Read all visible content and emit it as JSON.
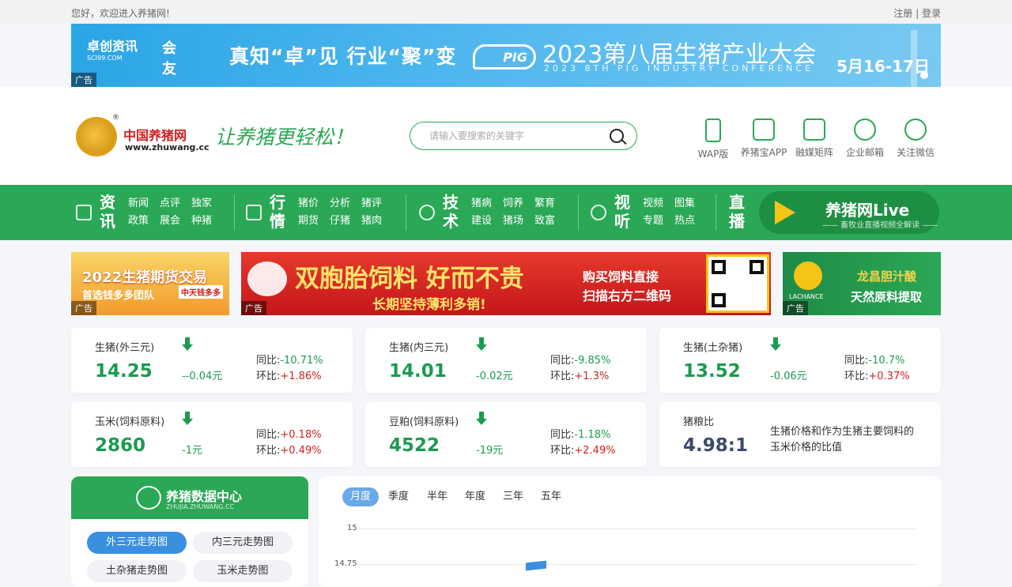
{
  "topbar": {
    "welcome": "您好，欢迎进入养猪网!",
    "register": "注册",
    "separator": "|",
    "login": "登录"
  },
  "banner": {
    "logo1": "卓创资讯",
    "logo1_sub": "SCI99.COM",
    "logo2": "会友",
    "slogan": "真知“卓”见  行业“聚”变",
    "pig_logo": "PIG",
    "conference": "2023第八届生猪产业大会",
    "conference_en": "2023 8TH PIG INDUSTRY CONFERENCE",
    "date": "5月16-17日",
    "ad_tag": "广告"
  },
  "header": {
    "logo_cn": "中国养猪网",
    "logo_en": "www.zhuwang.cc",
    "logo_mark": "®",
    "motto": "让养猪更轻松！",
    "search_placeholder": "请输入要搜索的关键字",
    "quick_links": [
      {
        "label": "WAP版",
        "icon": "phone-icon"
      },
      {
        "label": "养猪宝APP",
        "icon": "app-icon"
      },
      {
        "label": "融媒矩阵",
        "icon": "matrix-icon"
      },
      {
        "label": "企业邮箱",
        "icon": "mail-icon"
      },
      {
        "label": "关注微信",
        "icon": "wechat-icon"
      }
    ]
  },
  "nav": {
    "groups": [
      {
        "title": "资讯",
        "icon": "news-icon",
        "links": [
          "新闻",
          "点评",
          "独家",
          "政策",
          "展会",
          "种猪"
        ]
      },
      {
        "title": "行情",
        "icon": "chart-icon",
        "links": [
          "猪价",
          "分析",
          "猪评",
          "期货",
          "仔猪",
          "猪肉"
        ]
      },
      {
        "title": "技术",
        "icon": "wrench-icon",
        "links": [
          "猪病",
          "饲养",
          "繁育",
          "建设",
          "猪场",
          "致富"
        ]
      },
      {
        "title": "视听",
        "icon": "video-icon",
        "links": [
          "视频",
          "图集",
          "专题",
          "热点"
        ]
      }
    ],
    "live_label": "直播",
    "live_title": "养猪网Live",
    "live_sub": "—— 畜牧业直播视频全解读 ——"
  },
  "ads": {
    "ad1_line1": "2022生猪期货交易",
    "ad1_line2": "首选钱多多团队",
    "ad1_badge": "中天钱多多",
    "ad2_big": "双胞胎饲料 好而不贵",
    "ad2_sub": "长期坚持薄利多销!",
    "ad2_buy": "购买饲料直接",
    "ad2_scan": "扫描右方二维码",
    "ad3_brand": "LACHANCE",
    "ad3_line1": "龙昌胆汁酸",
    "ad3_line2": "天然原料提取",
    "tag": "广告"
  },
  "prices": [
    {
      "name": "生猪(外三元)",
      "price": "14.25",
      "change": "--0.04元",
      "yoy_label": "同比:",
      "yoy": "-10.71%",
      "mom_label": "环比:",
      "mom": "+1.86%"
    },
    {
      "name": "生猪(内三元)",
      "price": "14.01",
      "change": "-0.02元",
      "yoy_label": "同比:",
      "yoy": "-9.85%",
      "mom_label": "环比:",
      "mom": "+1.3%"
    },
    {
      "name": "生猪(土杂猪)",
      "price": "13.52",
      "change": "-0.06元",
      "yoy_label": "同比:",
      "yoy": "-10.7%",
      "mom_label": "环比:",
      "mom": "+0.37%"
    },
    {
      "name": "玉米(饲料原料)",
      "price": "2860",
      "change": "-1元",
      "yoy_label": "同比:",
      "yoy": "+0.18%",
      "mom_label": "环比:",
      "mom": "+0.49%"
    },
    {
      "name": "豆粕(饲料原料)",
      "price": "4522",
      "change": "-19元",
      "yoy_label": "同比:",
      "yoy": "-1.18%",
      "mom_label": "环比:",
      "mom": "+2.49%"
    }
  ],
  "ratio": {
    "name": "猪粮比",
    "value": "4.98:1",
    "desc": "生猪价格和作为生猪主要饲料的玉米价格的比值"
  },
  "data_center": {
    "title": "养猪数据中心",
    "subtitle": "ZHUJIA.ZHUWANG.CC",
    "pills": [
      "外三元走势图",
      "内三元走势图",
      "土杂猪走势图",
      "玉米走势图"
    ]
  },
  "chart": {
    "tabs": [
      "月度",
      "季度",
      "半年",
      "年度",
      "三年",
      "五年"
    ],
    "y_ticks": [
      "15",
      "14.75"
    ]
  },
  "colors": {
    "brand_green": "#2aa855",
    "down_green": "#1b9b50",
    "up_red": "#d21f1f",
    "accent_blue": "#3a8fe0"
  }
}
